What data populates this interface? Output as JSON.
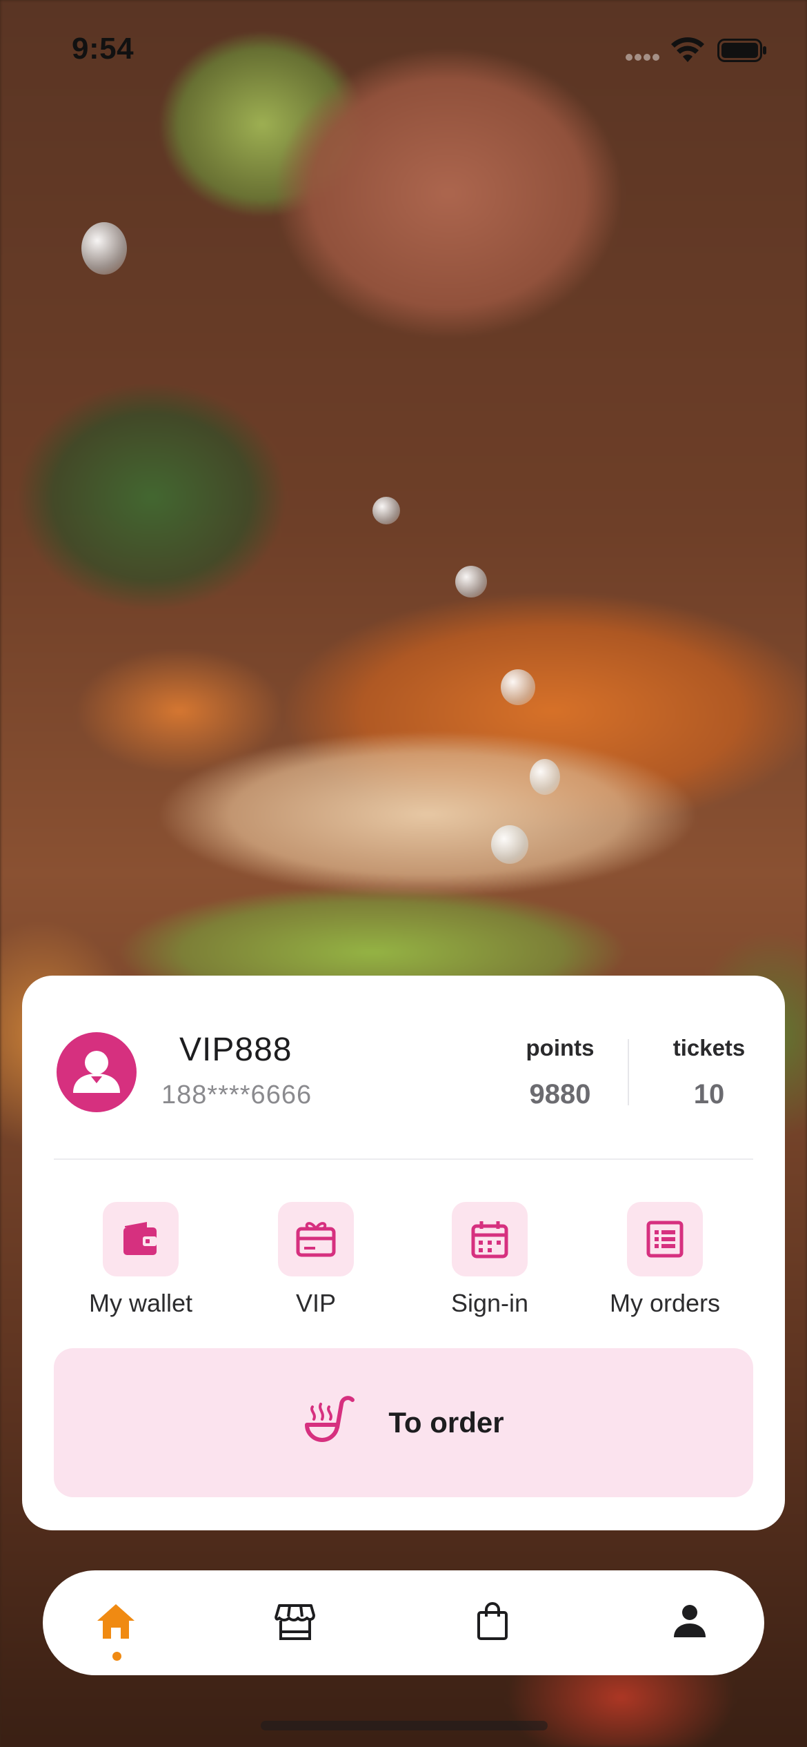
{
  "status_bar": {
    "time": "9:54"
  },
  "account": {
    "username": "VIP888",
    "phone": "188****6666",
    "stats": [
      {
        "label": "points",
        "value": "9880"
      },
      {
        "label": "tickets",
        "value": "10"
      }
    ]
  },
  "actions": [
    {
      "label": "My wallet",
      "icon": "wallet-icon"
    },
    {
      "label": "VIP",
      "icon": "gift-card-icon"
    },
    {
      "label": "Sign-in",
      "icon": "calendar-icon"
    },
    {
      "label": "My orders",
      "icon": "order-list-icon"
    }
  ],
  "order_button": {
    "label": "To order",
    "icon": "ladle-icon"
  },
  "tab_bar": {
    "tabs": [
      {
        "name": "home",
        "icon": "home-icon",
        "active": true
      },
      {
        "name": "store",
        "icon": "store-icon",
        "active": false
      },
      {
        "name": "bag",
        "icon": "shopping-bag-icon",
        "active": false
      },
      {
        "name": "profile",
        "icon": "person-icon",
        "active": false
      }
    ]
  },
  "colors": {
    "accent": "#d6307f",
    "accent_soft": "#fce4ee",
    "tab_active": "#f08a12",
    "tab_inactive": "#1d1d1f"
  }
}
